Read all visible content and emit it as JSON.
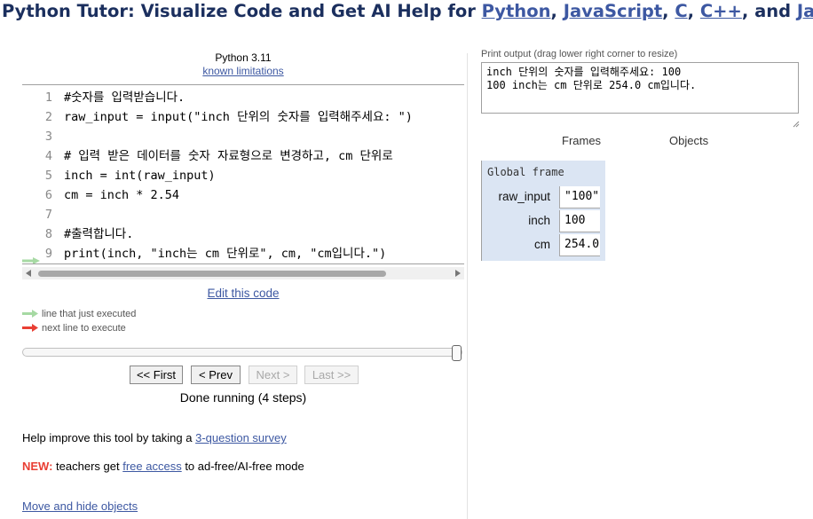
{
  "header": {
    "prefix": "Python Tutor: Visualize Code and Get AI Help for ",
    "link_python": "Python",
    "sep1": ", ",
    "link_js": "JavaScript",
    "sep2": ", ",
    "link_c": "C",
    "sep3": ", ",
    "link_cpp": "C++",
    "sep4": ", and ",
    "link_java": "Java"
  },
  "editor": {
    "language": "Python 3.11",
    "limitations_link": "known limitations",
    "lines": [
      {
        "no": "1",
        "text": "#숫자를 입력받습니다."
      },
      {
        "no": "2",
        "text": "raw_input = input(\"inch 단위의 숫자를 입력해주세요: \")"
      },
      {
        "no": "3",
        "text": ""
      },
      {
        "no": "4",
        "text": "# 입력 받은 데이터를 숫자 자료형으로 변경하고, cm 단위로"
      },
      {
        "no": "5",
        "text": "inch = int(raw_input)"
      },
      {
        "no": "6",
        "text": "cm = inch * 2.54"
      },
      {
        "no": "7",
        "text": ""
      },
      {
        "no": "8",
        "text": "#출력합니다."
      },
      {
        "no": "9",
        "text": "print(inch, \"inch는 cm 단위로\", cm, \"cm입니다.\")"
      }
    ],
    "current_line": 9,
    "edit_link": "Edit this code"
  },
  "legend": {
    "just_executed": "line that just executed",
    "next_line": "next line to execute",
    "just_executed_color": "#a6d9a3",
    "next_line_color": "#e93f34"
  },
  "navigation": {
    "first": "<< First",
    "prev": "< Prev",
    "next": "Next >",
    "last": "Last >>",
    "status": "Done running (4 steps)",
    "step_progress": 1.0
  },
  "footer": {
    "survey_prefix": "Help improve this tool by taking a ",
    "survey_link": "3-question survey",
    "new_label": "NEW:",
    "new_text_1": " teachers get ",
    "free_access_link": "free access",
    "new_text_2": " to ad-free/AI-free mode",
    "move_hide_link": "Move and hide objects"
  },
  "output": {
    "label": "Print output (drag lower right corner to resize)",
    "text": "inch 단위의 숫자를 입력해주세요: 100\n100 inch는 cm 단위로 254.0 cm입니다."
  },
  "visualization": {
    "frames_header": "Frames",
    "objects_header": "Objects",
    "global_frame_title": "Global frame",
    "variables": [
      {
        "name": "raw_input",
        "value": "\"100\""
      },
      {
        "name": "inch",
        "value": "100"
      },
      {
        "name": "cm",
        "value": "254.0"
      }
    ],
    "frame_bg_color": "#dbe5f3"
  },
  "colors": {
    "header_text": "#1b2f5e",
    "link": "#3d58a2"
  }
}
